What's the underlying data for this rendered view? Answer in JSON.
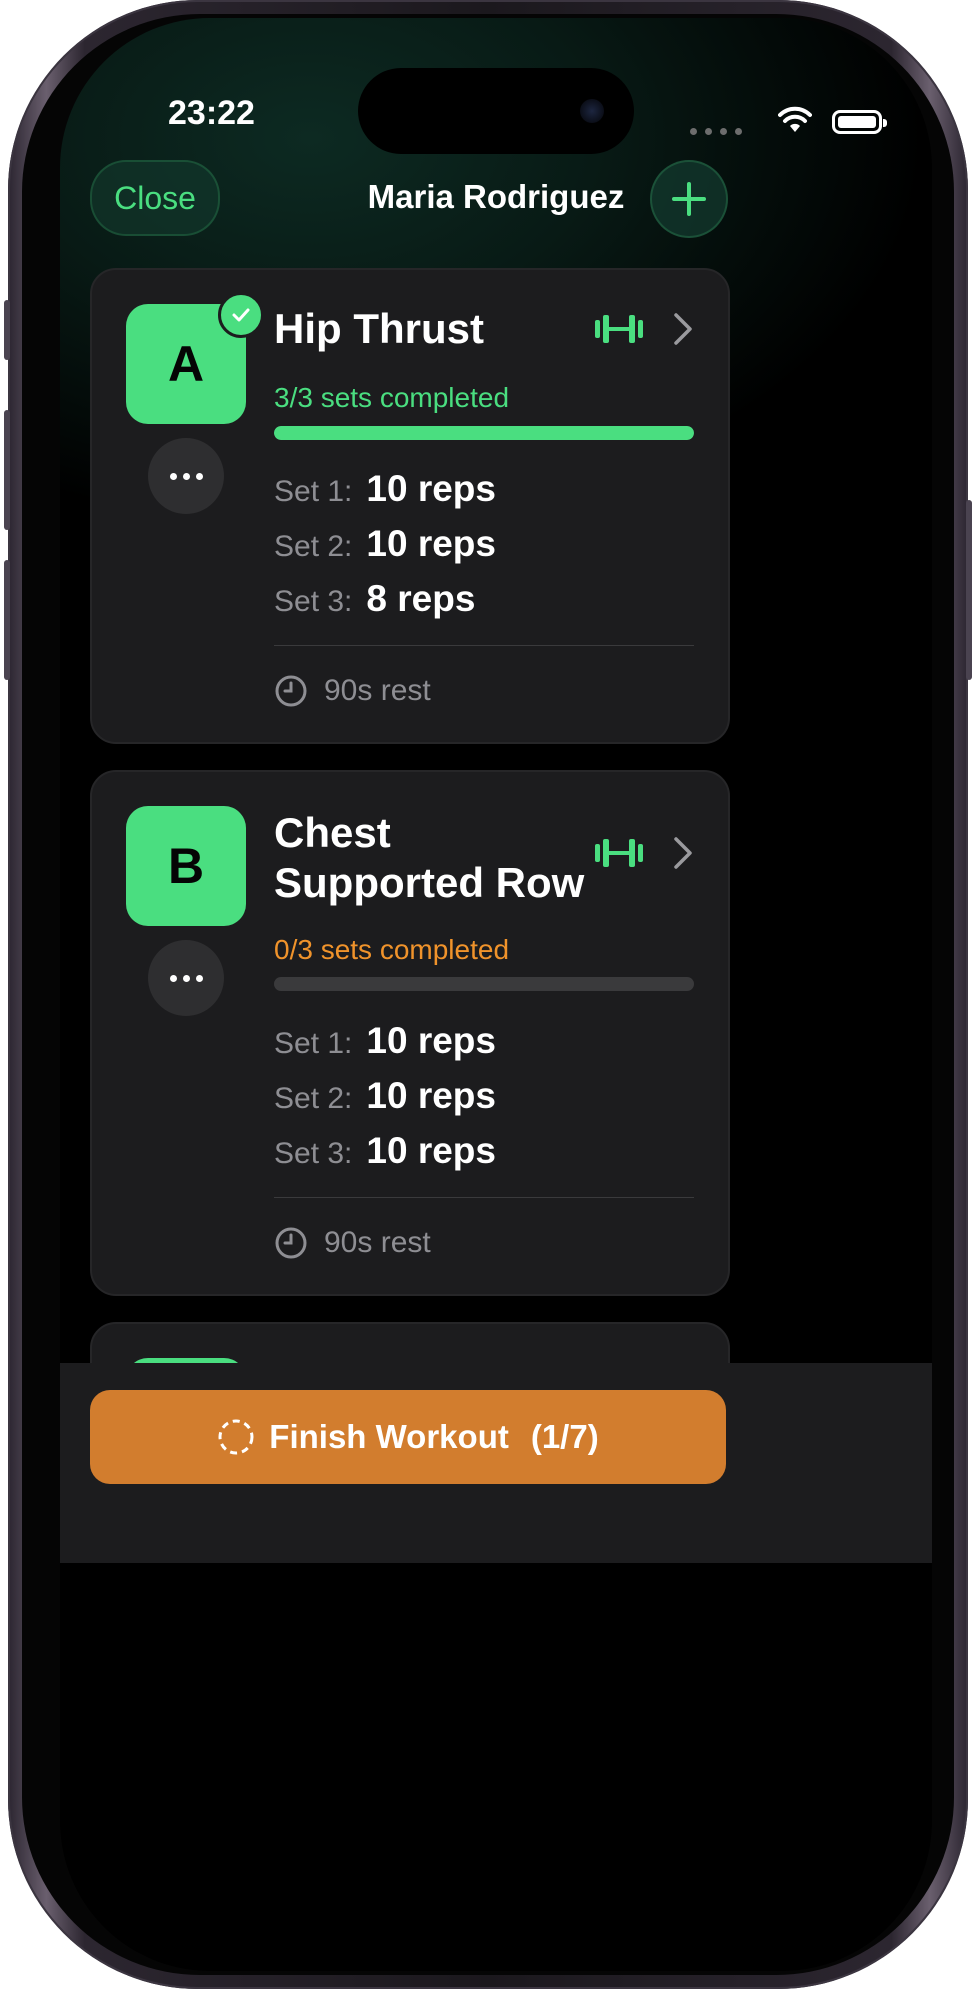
{
  "status_bar": {
    "time": "23:22"
  },
  "header": {
    "close_label": "Close",
    "title": "Maria Rodriguez",
    "add_icon": "plus-icon"
  },
  "exercises": [
    {
      "letter": "A",
      "name_line1": "Hip Thrust",
      "name_line2": "",
      "completed": true,
      "status_text": "3/3 sets completed",
      "status_color": "#4ade80",
      "progress": 1.0,
      "sets": [
        {
          "label": "Set 1:",
          "value": "10 reps"
        },
        {
          "label": "Set 2:",
          "value": "10 reps"
        },
        {
          "label": "Set 3:",
          "value": "8 reps"
        }
      ],
      "rest": "90s rest"
    },
    {
      "letter": "B",
      "name_line1": "Chest",
      "name_line2": "Supported Row",
      "completed": false,
      "status_text": "0/3 sets completed",
      "status_color": "#f0932b",
      "progress": 0.0,
      "sets": [
        {
          "label": "Set 1:",
          "value": "10 reps"
        },
        {
          "label": "Set 2:",
          "value": "10 reps"
        },
        {
          "label": "Set 3:",
          "value": "10 reps"
        }
      ],
      "rest": "90s rest"
    }
  ],
  "footer": {
    "finish_label": "Finish Workout",
    "finish_count": "(1/7)"
  },
  "colors": {
    "accent_green": "#4ade80",
    "accent_orange": "#f0932b",
    "finish_button": "#d27d2e",
    "card_bg": "#1c1c1e"
  },
  "icons": [
    "dumbbell-icon",
    "chevron-right-icon",
    "clock-icon",
    "dashed-circle-icon",
    "checkmark-icon",
    "more-icon",
    "wifi-icon",
    "battery-icon",
    "signal-icon"
  ]
}
